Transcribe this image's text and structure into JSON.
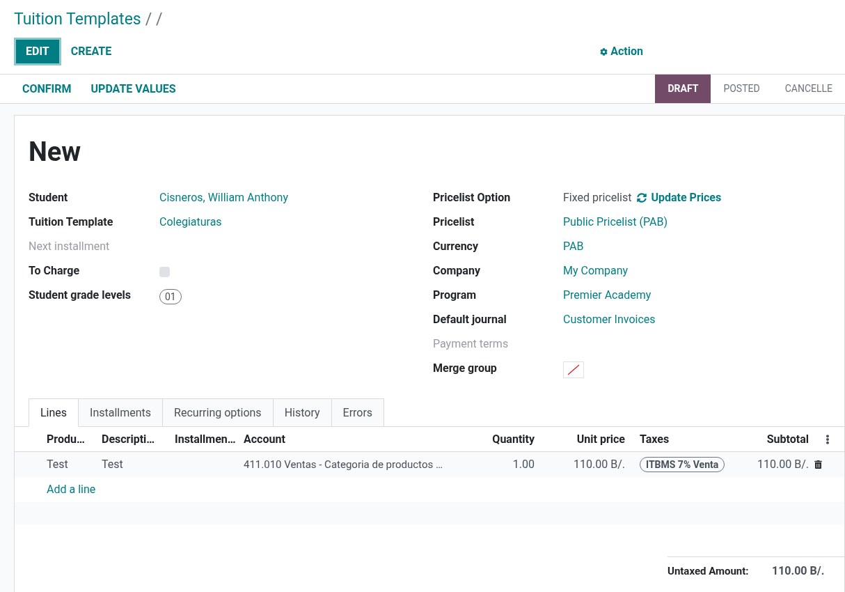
{
  "breadcrumb": {
    "title": "Tuition Templates",
    "separators": "/ /"
  },
  "buttons": [
    {
      "label": "EDIT",
      "kind": "primary"
    },
    {
      "label": "CREATE",
      "kind": "link"
    }
  ],
  "action": {
    "label": "Action"
  },
  "header_buttons": [
    "CONFIRM",
    "UPDATE VALUES"
  ],
  "status_steps": [
    {
      "label": "DRAFT",
      "selected": true
    },
    {
      "label": "POSTED",
      "selected": false
    },
    {
      "label": "CANCELLE",
      "selected": false
    }
  ],
  "record": {
    "title": "New"
  },
  "left_fields": [
    {
      "label": "Student",
      "kind": "link",
      "value": "Cisneros, William Anthony",
      "muted": false
    },
    {
      "label": "Tuition Template",
      "kind": "link",
      "value": "Colegiaturas",
      "muted": false
    },
    {
      "label": "Next installment",
      "kind": "empty",
      "muted": true
    },
    {
      "label": "To Charge",
      "kind": "checkbox",
      "checked": false,
      "muted": false
    },
    {
      "label": "Student grade levels",
      "kind": "tag",
      "value": "01",
      "muted": false
    }
  ],
  "right_fields": [
    {
      "label": "Pricelist Option",
      "kind": "text_action",
      "value": "Fixed pricelist",
      "action": "Update Prices",
      "muted": false
    },
    {
      "label": "Pricelist",
      "kind": "link",
      "value": "Public Pricelist (PAB)",
      "muted": false
    },
    {
      "label": "Currency",
      "kind": "link",
      "value": "PAB",
      "muted": false
    },
    {
      "label": "Company",
      "kind": "link",
      "value": "My Company",
      "muted": false
    },
    {
      "label": "Program",
      "kind": "link",
      "value": "Premier Academy",
      "muted": false
    },
    {
      "label": "Default journal",
      "kind": "link",
      "value": "Customer Invoices",
      "muted": false
    },
    {
      "label": "Payment terms",
      "kind": "empty",
      "muted": true
    },
    {
      "label": "Merge group",
      "kind": "swatch",
      "muted": false
    }
  ],
  "tabs": [
    {
      "label": "Lines",
      "selected": true
    },
    {
      "label": "Installments",
      "selected": false
    },
    {
      "label": "Recurring options",
      "selected": false
    },
    {
      "label": "History",
      "selected": false
    },
    {
      "label": "Errors",
      "selected": false
    }
  ],
  "table": {
    "columns": [
      "Produ…",
      "Descripti…",
      "Installmen…",
      "Account",
      "Quantity",
      "Unit price",
      "Taxes",
      "Subtotal"
    ],
    "rows": [
      {
        "product": "Test",
        "description": "Test",
        "installment": "",
        "account": "411.010 Ventas - Categoria de productos …",
        "quantity": "1.00",
        "unit_price": "110.00 B/.",
        "tax": "ITBMS 7% Venta",
        "subtotal": "110.00 B/."
      }
    ],
    "add_line": "Add a line"
  },
  "totals": [
    {
      "label": "Untaxed Amount:",
      "value": "110.00 B/."
    }
  ]
}
